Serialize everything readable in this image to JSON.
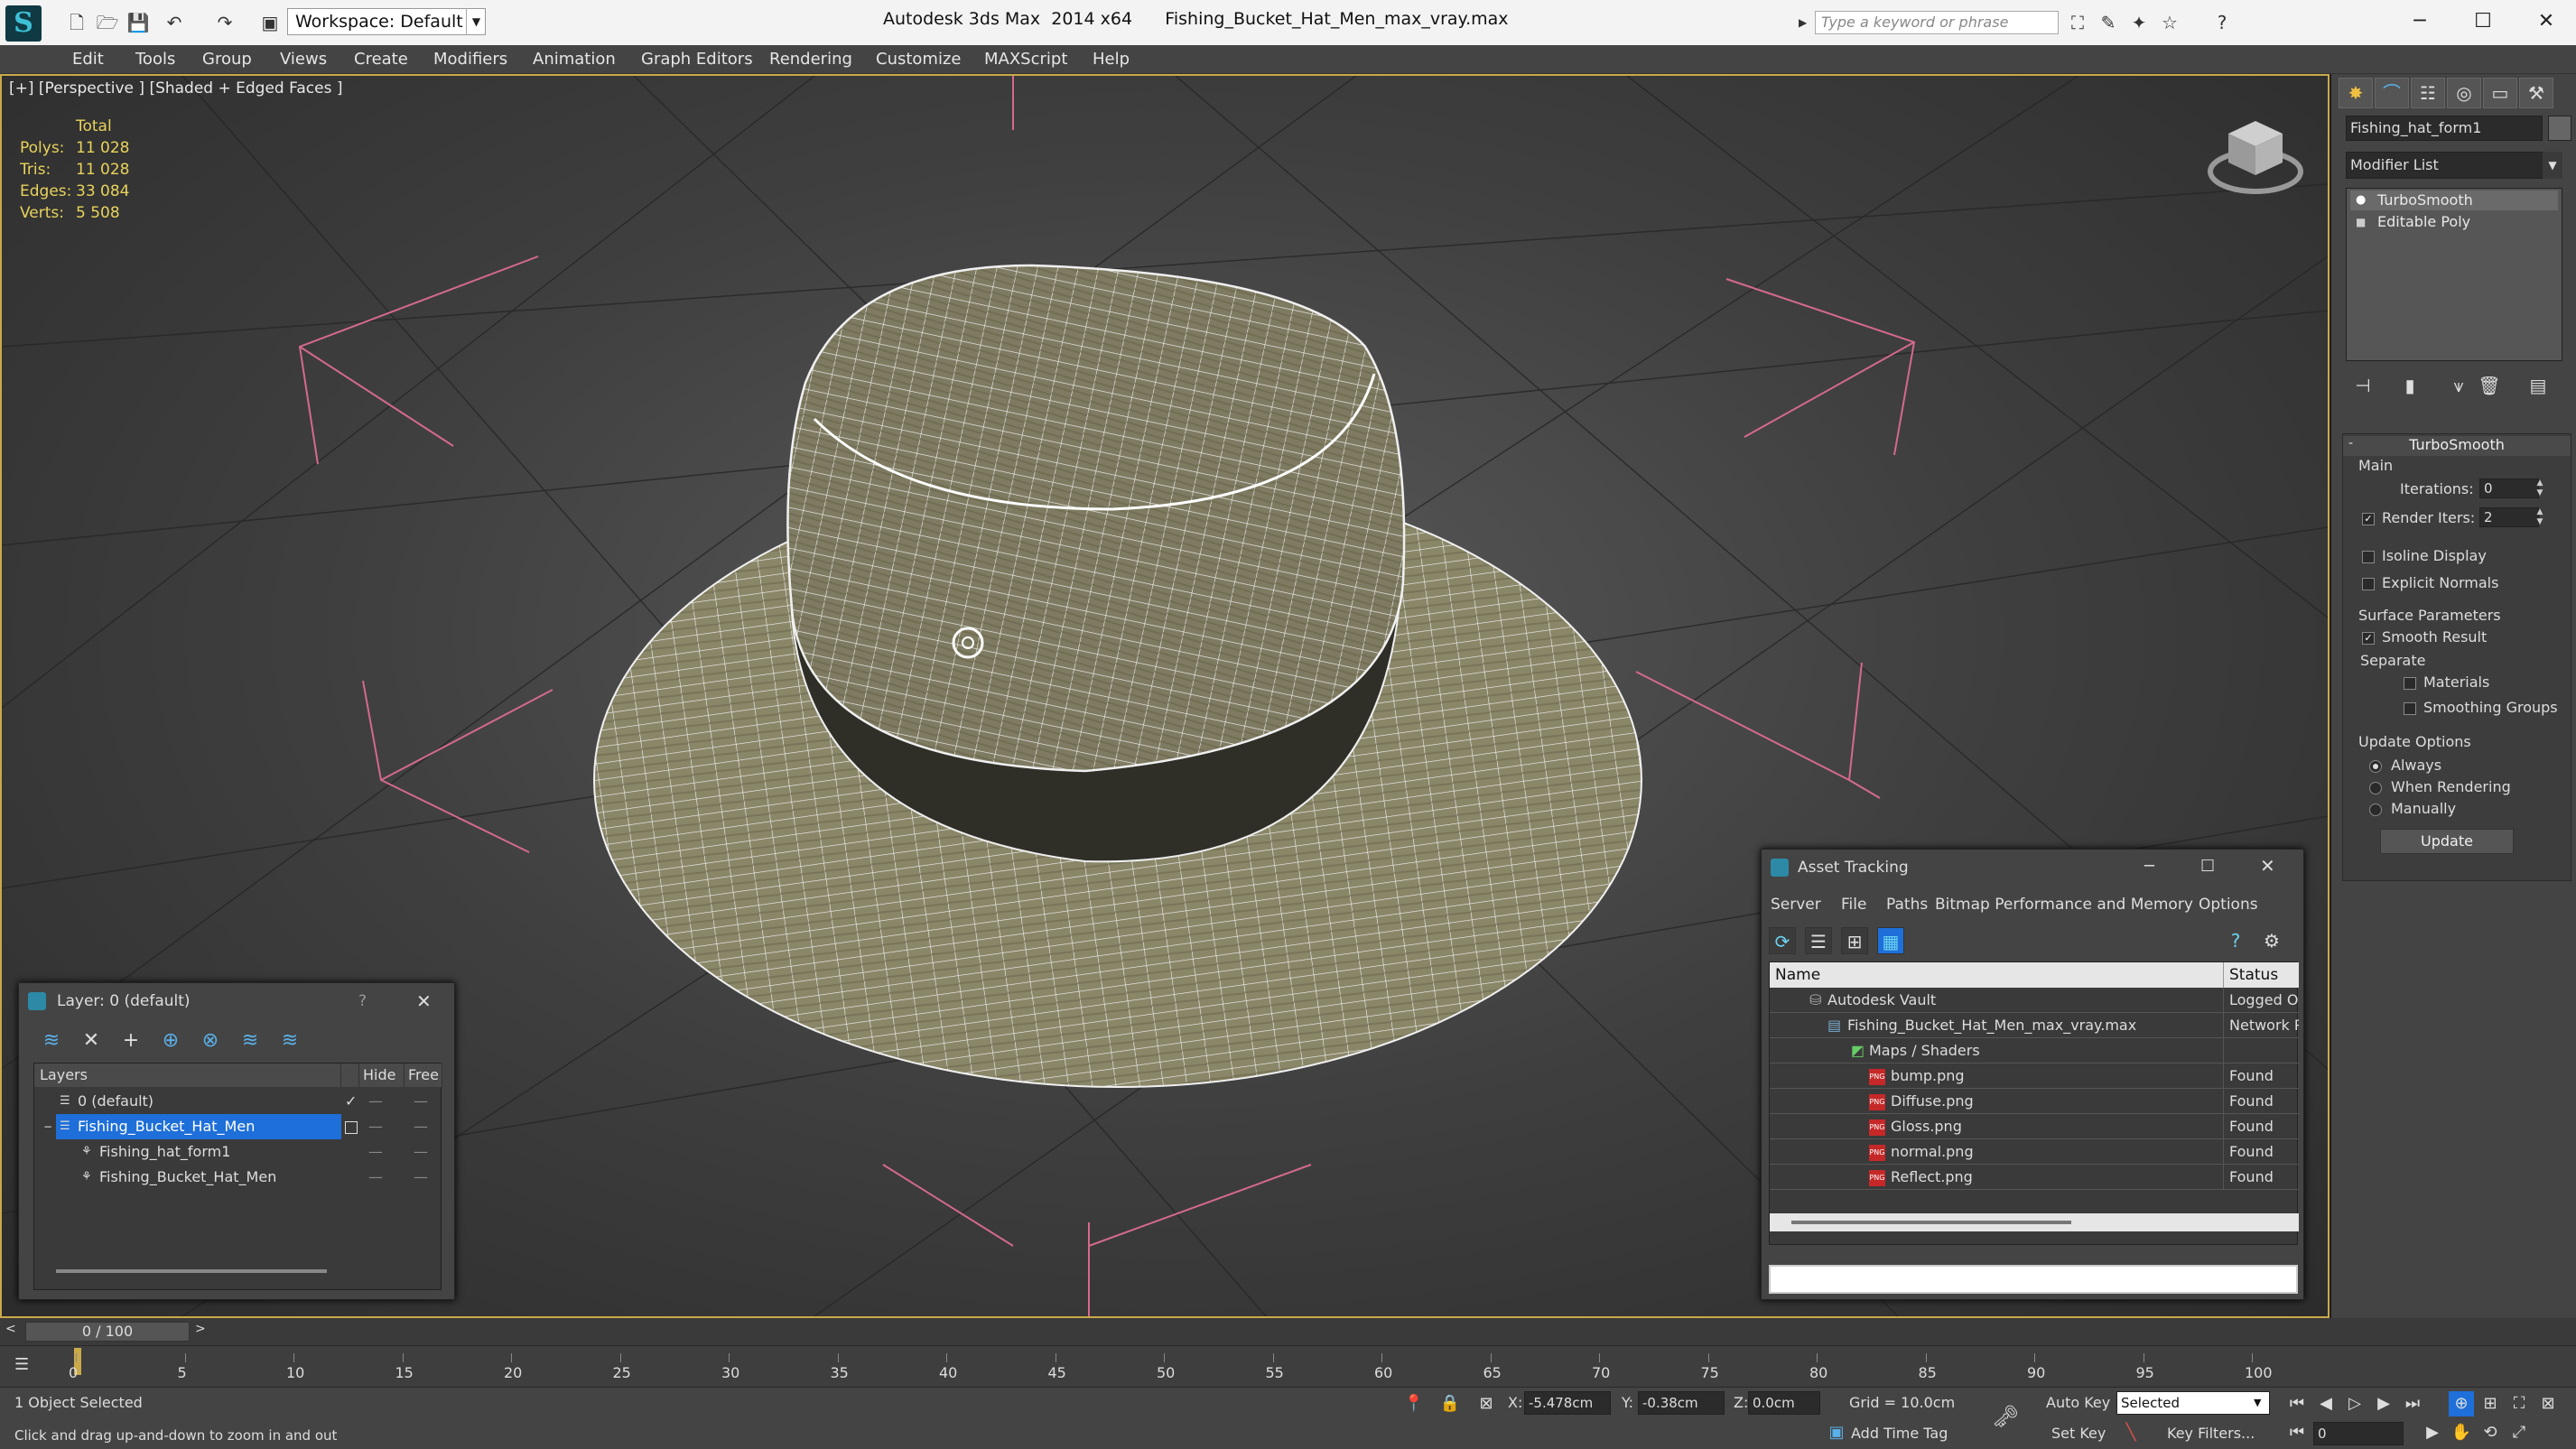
{
  "app": {
    "title": "Autodesk 3ds Max  2014 x64      Fishing_Bucket_Hat_Men_max_vray.max",
    "workspace": "Workspace: Default",
    "search_placeholder": "Type a keyword or phrase"
  },
  "menu": [
    "Edit",
    "Tools",
    "Group",
    "Views",
    "Create",
    "Modifiers",
    "Animation",
    "Graph Editors",
    "Rendering",
    "Customize",
    "MAXScript",
    "Help"
  ],
  "viewport": {
    "label": "[+] [Perspective ] [Shaded + Edged Faces ]",
    "stats_header": "Total",
    "stats": [
      {
        "label": "Polys:",
        "value": "11 028"
      },
      {
        "label": "Tris:",
        "value": "11 028"
      },
      {
        "label": "Edges:",
        "value": "33 084"
      },
      {
        "label": "Verts:",
        "value": "5 508"
      }
    ]
  },
  "command_panel": {
    "object_name": "Fishing_hat_form1",
    "modifier_list": "Modifier List",
    "stack": [
      "TurboSmooth",
      "Editable Poly"
    ],
    "turbosmooth": {
      "title": "TurboSmooth",
      "main": "Main",
      "iterations_label": "Iterations:",
      "iterations": "0",
      "render_iters_label": "Render Iters:",
      "render_iters": "2",
      "render_iters_checked": true,
      "isoline": "Isoline Display",
      "isoline_checked": false,
      "explicit_normals": "Explicit Normals",
      "explicit_checked": false,
      "surface_params": "Surface Parameters",
      "smooth_result": "Smooth Result",
      "smooth_checked": true,
      "separate": "Separate",
      "materials": "Materials",
      "materials_checked": false,
      "smoothing_groups": "Smoothing Groups",
      "smoothing_checked": false,
      "update_options": "Update Options",
      "always": "Always",
      "when_rendering": "When Rendering",
      "manually": "Manually",
      "selected_update": "Always",
      "update_button": "Update"
    }
  },
  "layer_dialog": {
    "title": "Layer: 0 (default)",
    "help": "?",
    "col_layers": "Layers",
    "col_hide": "Hide",
    "col_freeze": "Free",
    "rows": [
      {
        "name": "0 (default)",
        "indent": 1,
        "selected": false,
        "current": true
      },
      {
        "name": "Fishing_Bucket_Hat_Men",
        "indent": 1,
        "selected": true,
        "current": false
      },
      {
        "name": "Fishing_hat_form1",
        "indent": 2,
        "selected": false,
        "current": false
      },
      {
        "name": "Fishing_Bucket_Hat_Men",
        "indent": 2,
        "selected": false,
        "current": false
      }
    ]
  },
  "asset_dialog": {
    "title": "Asset Tracking",
    "menu": [
      "Server",
      "File",
      "Paths",
      "Bitmap Performance and Memory",
      "Options"
    ],
    "col_name": "Name",
    "col_status": "Status",
    "rows": [
      {
        "name": "Autodesk Vault",
        "status": "Logged Ou",
        "icon": "vault-icon",
        "indent": 1
      },
      {
        "name": "Fishing_Bucket_Hat_Men_max_vray.max",
        "status": "Network P",
        "icon": "max-file-icon",
        "indent": 2
      },
      {
        "name": "Maps / Shaders",
        "status": "",
        "icon": "maps-icon",
        "indent": 3
      },
      {
        "name": "bump.png",
        "status": "Found",
        "icon": "png-icon",
        "indent": 4
      },
      {
        "name": "Diffuse.png",
        "status": "Found",
        "icon": "png-icon",
        "indent": 4
      },
      {
        "name": "Gloss.png",
        "status": "Found",
        "icon": "png-icon",
        "indent": 4
      },
      {
        "name": "normal.png",
        "status": "Found",
        "icon": "png-icon",
        "indent": 4
      },
      {
        "name": "Reflect.png",
        "status": "Found",
        "icon": "png-icon",
        "indent": 4
      }
    ]
  },
  "timeline": {
    "slider": "0 / 100",
    "ticks": [
      "0",
      "5",
      "10",
      "15",
      "20",
      "25",
      "30",
      "35",
      "40",
      "45",
      "50",
      "55",
      "60",
      "65",
      "70",
      "75",
      "80",
      "85",
      "90",
      "95",
      "100"
    ]
  },
  "status": {
    "selection": "1 Object Selected",
    "prompt": "Click and drag up-and-down to zoom in and out",
    "x_label": "X:",
    "x": "-5.478cm",
    "y_label": "Y:",
    "y": "-0.38cm",
    "z_label": "Z:",
    "z": "0.0cm",
    "grid": "Grid = 10.0cm",
    "auto_key": "Auto Key",
    "set_key": "Set Key",
    "selected": "Selected",
    "key_filters": "Key Filters...",
    "add_time_tag": "Add Time Tag",
    "frame": "0"
  },
  "colors": {
    "accent": "#c9a94a",
    "stats": "#e8d35c",
    "selection": "#1e6fd9"
  }
}
